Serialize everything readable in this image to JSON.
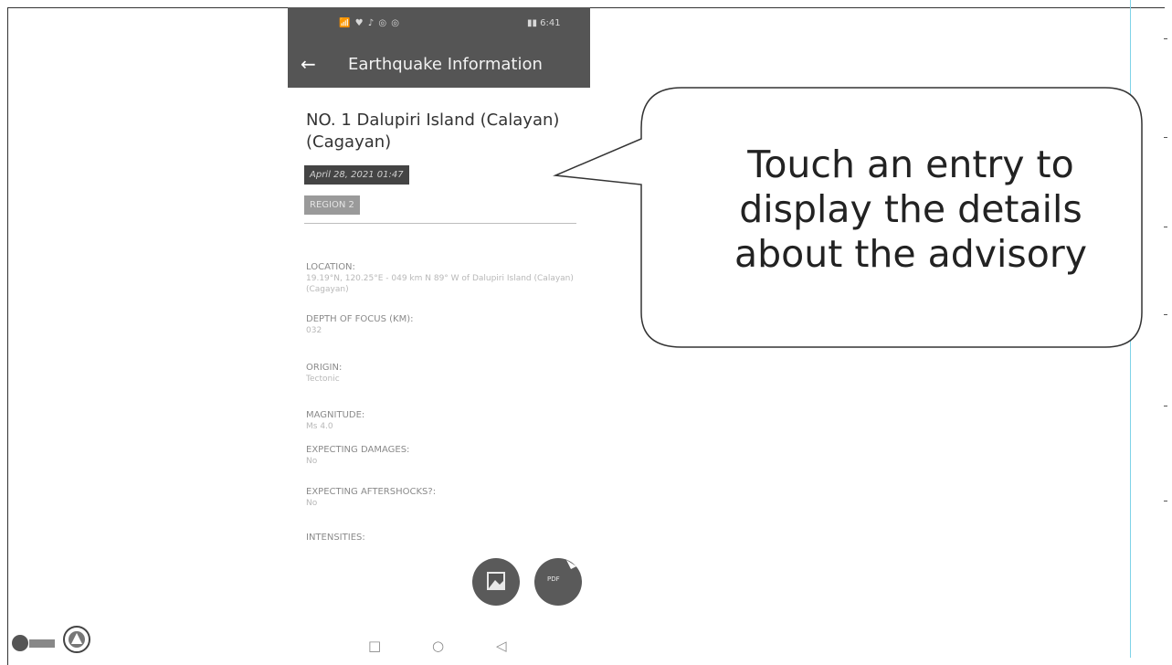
{
  "status_bar": {
    "left": "📶 ♥ ♪ ◎ ◎",
    "right": "▮▮ 6:41"
  },
  "app_bar": {
    "title": "Earthquake Information"
  },
  "quake": {
    "title": "NO. 1 Dalupiri Island (Calayan) (Cagayan)",
    "date": "April 28, 2021 01:47",
    "region": "REGION 2"
  },
  "fields": [
    {
      "label": "LOCATION:",
      "value": "19.19°N, 120.25°E - 049 km N 89° W of Dalupiri Island (Calayan) (Cagayan)"
    },
    {
      "label": "DEPTH OF FOCUS (KM):",
      "value": "032"
    },
    {
      "label": "ORIGIN:",
      "value": "Tectonic"
    },
    {
      "label": "MAGNITUDE:",
      "value": "Ms 4.0"
    },
    {
      "label": "EXPECTING DAMAGES:",
      "value": "No"
    },
    {
      "label": "EXPECTING AFTERSHOCKS?:",
      "value": "No"
    },
    {
      "label": "INTENSITIES:",
      "value": ""
    }
  ],
  "fab": {
    "pdf_label": "PDF"
  },
  "callout": {
    "text": "Touch an entry to display the details about the advisory"
  },
  "icons": {
    "back": "arrow-left-icon",
    "image": "image-icon",
    "pdf": "pdf-icon",
    "nav": [
      "square-icon",
      "circle-icon",
      "triangle-left-icon"
    ]
  }
}
